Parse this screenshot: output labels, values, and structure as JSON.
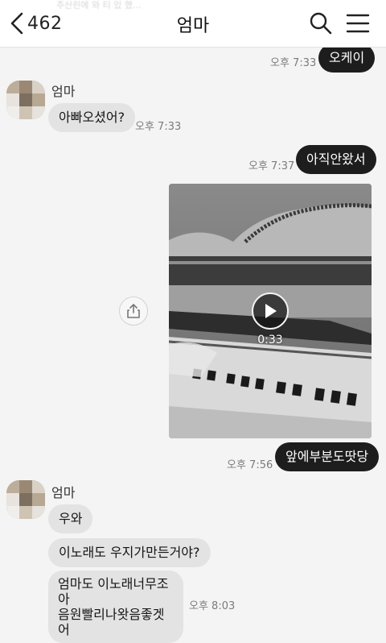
{
  "header": {
    "unread_count": "462",
    "title": "엄마",
    "ghost_preview": "주산린에 와 티 있 했..."
  },
  "messages": {
    "m1": {
      "text": "오케이",
      "time": "오후 7:33"
    },
    "sender1": {
      "name": "엄마"
    },
    "m2": {
      "text": "아빠오셨어?",
      "time": "오후 7:33"
    },
    "m3": {
      "text": "아직안왔서",
      "time": "오후 7:37"
    },
    "video": {
      "duration": "0:33"
    },
    "m4": {
      "text": "앞에부분도땃당",
      "time": "오후 7:56"
    },
    "sender2": {
      "name": "엄마"
    },
    "m5": {
      "text": "우와"
    },
    "m6": {
      "text": "이노래도 우지가만든거야?"
    },
    "m7": {
      "line1": "엄마도 이노래너무조아",
      "line2": "음원빨리나왓음좋겟어",
      "time": "오후 8:03"
    }
  },
  "icons": {
    "back": "chevron-left-icon",
    "search": "search-icon",
    "menu": "hamburger-menu-icon",
    "share": "share-icon",
    "play": "play-icon"
  },
  "colors": {
    "background": "#f4f4f4",
    "incoming_bubble": "#e3e3e3",
    "outgoing_bubble": "#1d1d1d"
  }
}
